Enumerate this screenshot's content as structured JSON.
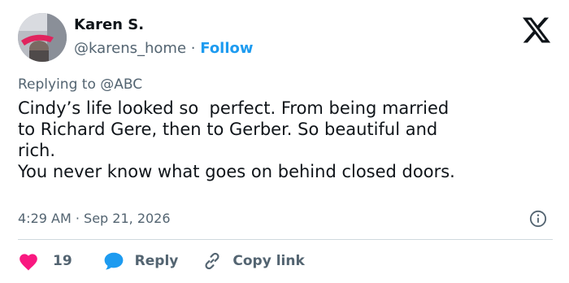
{
  "author": {
    "name": "Karen S.",
    "handle": "@karens_home",
    "separator": "·",
    "follow_label": "Follow"
  },
  "brand": {
    "icon": "x-logo-icon",
    "color": "#0f1419"
  },
  "reply_context": {
    "prefix": "Replying to",
    "mention": "@ABC"
  },
  "tweet": {
    "lines": [
      "Cindy’s life looked so  perfect. From being married",
      "to Richard Gere, then to Gerber. So beautiful and",
      "rich.",
      "You never know what goes on behind closed doors."
    ]
  },
  "meta": {
    "time": "4:29 AM",
    "separator": "·",
    "date": "Sep 21, 2026",
    "info_icon": "info-icon"
  },
  "actions": {
    "like_count": "19",
    "like_icon": "heart-icon",
    "reply_label": "Reply",
    "reply_icon": "speech-bubble-icon",
    "copy_label": "Copy link",
    "copy_icon": "link-icon"
  },
  "colors": {
    "accent": "#1d9bf0",
    "like": "#f91880",
    "muted_text": "#536471",
    "text": "#0f1419",
    "divider": "#cfd9de"
  }
}
